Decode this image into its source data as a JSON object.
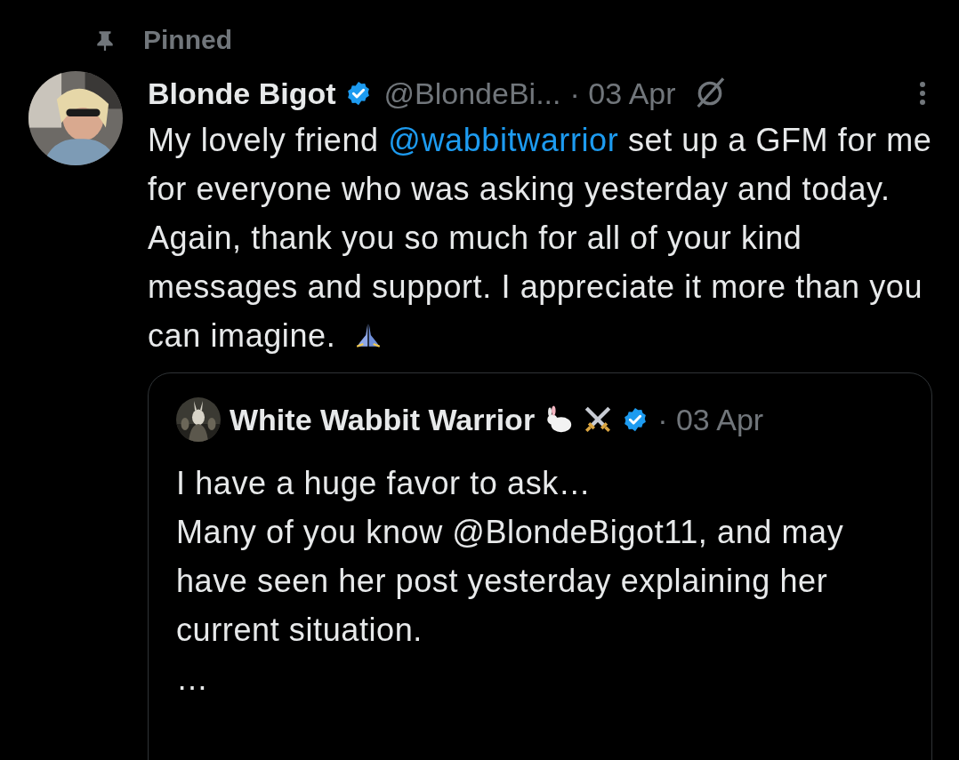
{
  "pinned": {
    "label": "Pinned"
  },
  "post": {
    "author": "Blonde Bigot",
    "verified": true,
    "handle": "@BlondeBi...",
    "date": "· 03 Apr",
    "paragraphs": [
      {
        "before": "My lovely friend ",
        "mention": "@wabbitwarrior",
        "after": " set up a GFM for me for everyone who was asking yesterday and today."
      },
      {
        "before": "Again, thank you so much for all of your kind messages and support. I appreciate it more than you can imagine.",
        "praying_emoji": true
      }
    ]
  },
  "quote": {
    "author": "White Wabbit Warrior",
    "verified": true,
    "date": "· 03 Apr",
    "lines": [
      "I have a huge favor to ask…",
      "Many of you know @BlondeBigot11, and may have seen her post yesterday explaining her current situation.",
      "…"
    ]
  }
}
